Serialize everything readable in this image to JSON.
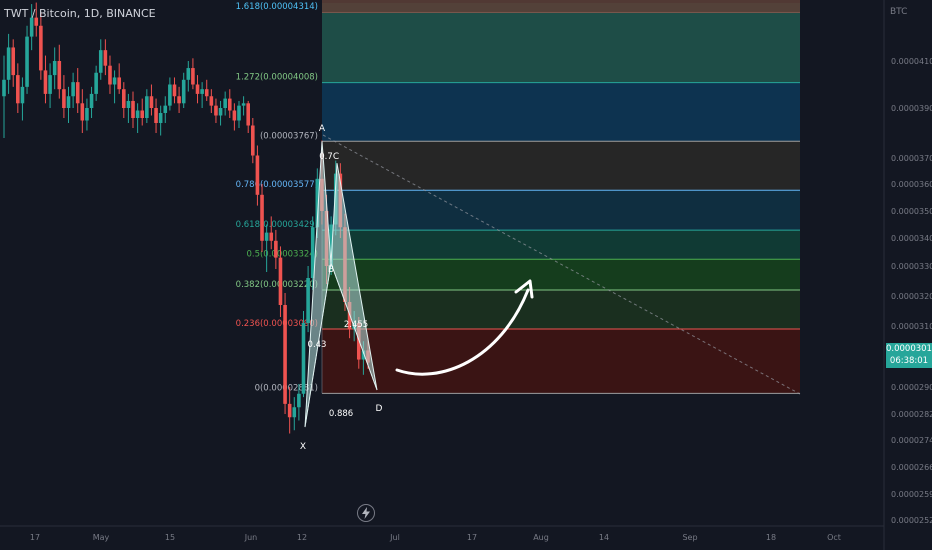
{
  "header": {
    "symbol_text": "TWT / Bitcoin, 1D, BINANCE",
    "axis_unit": "BTC"
  },
  "current_price": {
    "value": "0.00003017",
    "countdown": "06:38:01",
    "color": "#26a69a"
  },
  "toolbar": {
    "replay_icon": "lightning-bolt-icon"
  },
  "chart_data": {
    "type": "candlestick",
    "ylim": [
      2.48e-05,
      4.35e-05
    ],
    "y_ticks": [
      "0.00004100",
      "0.00003900",
      "0.00003700",
      "0.00003600",
      "0.00003500",
      "0.00003400",
      "0.00003300",
      "0.00003200",
      "0.00003100",
      "0.00002900",
      "0.00002820",
      "0.00002740",
      "0.00002660",
      "0.00002590",
      "0.00002520"
    ],
    "x_ticks": [
      "17",
      "May",
      "15",
      "Jun",
      "12",
      "Jul",
      "17",
      "Aug",
      "14",
      "Sep",
      "18",
      "Oct"
    ],
    "fib_levels": [
      {
        "ratio": "1.618",
        "value": "0.00004314",
        "label": "1.618(0.00004314)",
        "color": "#5d4037",
        "text_color": "#4fc3f7"
      },
      {
        "ratio": "1.272",
        "value": "0.00004008",
        "label": "1.272(0.00004008)",
        "color": "#26a69a",
        "text_color": "#81c784"
      },
      {
        "ratio": "1",
        "value": "0.00003767",
        "label": "(0.00003767)",
        "color": "#9e9e9e",
        "text_color": "#b2b5be"
      },
      {
        "ratio": "0.786",
        "value": "0.00003577",
        "label": "0.786(0.00003577)",
        "color": "#64b5f6",
        "text_color": "#64b5f6"
      },
      {
        "ratio": "0.618",
        "value": "0.00003429",
        "label": "0.618(0.00003429)",
        "color": "#26a69a",
        "text_color": "#26a69a"
      },
      {
        "ratio": "0.5",
        "value": "0.00003324",
        "label": "0.5(0.00003324)",
        "color": "#4caf50",
        "text_color": "#4caf50"
      },
      {
        "ratio": "0.382",
        "value": "0.00003220",
        "label": "0.382(0.00003220)",
        "color": "#81c784",
        "text_color": "#81c784"
      },
      {
        "ratio": "0.236",
        "value": "0.00003090",
        "label": "0.236(0.00003090)",
        "color": "#ef5350",
        "text_color": "#ef5350"
      },
      {
        "ratio": "0",
        "value": "0.00002881",
        "label": "0(0.00002881)",
        "color": "#9e9e9e",
        "text_color": "#b2b5be"
      }
    ],
    "fib_bands": [
      {
        "from": "1.618",
        "to": "1.272",
        "color": "#1e4d47"
      },
      {
        "from": "1.272",
        "to": "1",
        "color": "#0d3350"
      },
      {
        "from": "1",
        "to": "0.786",
        "color": "#262626"
      },
      {
        "from": "0.786",
        "to": "0.618",
        "color": "#0f2e40"
      },
      {
        "from": "0.618",
        "to": "0.5",
        "color": "#103a34"
      },
      {
        "from": "0.5",
        "to": "0.382",
        "color": "#153d1d"
      },
      {
        "from": "0.382",
        "to": "0.236",
        "color": "#1a2f1f"
      },
      {
        "from": "0.236",
        "to": "0",
        "color": "#3a1414"
      }
    ],
    "pattern_points": [
      {
        "label": "X",
        "price": 2.78e-05
      },
      {
        "label": "A",
        "price": 3.767e-05
      },
      {
        "label": "B",
        "price": 3.31e-05
      },
      {
        "label": "C",
        "price": 3.68e-05
      },
      {
        "label": "D",
        "price": 2.87e-05
      }
    ],
    "pattern_ratios": [
      "0.7",
      "0.43",
      "2.455",
      "0.886"
    ],
    "candles": [
      [
        3.95e-05,
        4.12e-05,
        3.78e-05,
        4.02e-05
      ],
      [
        4.02e-05,
        4.2e-05,
        3.96e-05,
        4.15e-05
      ],
      [
        4.15e-05,
        4.18e-05,
        3.99e-05,
        4.04e-05
      ],
      [
        4.04e-05,
        4.09e-05,
        3.88e-05,
        3.92e-05
      ],
      [
        3.92e-05,
        4.03e-05,
        3.85e-05,
        3.99e-05
      ],
      [
        3.99e-05,
        4.23e-05,
        3.96e-05,
        4.19e-05
      ],
      [
        4.19e-05,
        4.31e-05,
        4.14e-05,
        4.26e-05
      ],
      [
        4.26e-05,
        4.33e-05,
        4.19e-05,
        4.23e-05
      ],
      [
        4.23e-05,
        4.28e-05,
        4.02e-05,
        4.06e-05
      ],
      [
        4.06e-05,
        4.12e-05,
        3.92e-05,
        3.96e-05
      ],
      [
        3.96e-05,
        4.09e-05,
        3.9e-05,
        4.04e-05
      ],
      [
        4.04e-05,
        4.15e-05,
        3.98e-05,
        4.1e-05
      ],
      [
        4.1e-05,
        4.16e-05,
        3.94e-05,
        3.98e-05
      ],
      [
        3.98e-05,
        4.04e-05,
        3.86e-05,
        3.9e-05
      ],
      [
        3.9e-05,
        3.99e-05,
        3.84e-05,
        3.95e-05
      ],
      [
        3.95e-05,
        4.05e-05,
        3.9e-05,
        4.01e-05
      ],
      [
        4.01e-05,
        4.07e-05,
        3.88e-05,
        3.92e-05
      ],
      [
        3.92e-05,
        3.98e-05,
        3.8e-05,
        3.85e-05
      ],
      [
        3.85e-05,
        3.94e-05,
        3.81e-05,
        3.9e-05
      ],
      [
        3.9e-05,
        3.99e-05,
        3.86e-05,
        3.96e-05
      ],
      [
        3.96e-05,
        4.08e-05,
        3.93e-05,
        4.05e-05
      ],
      [
        4.05e-05,
        4.18e-05,
        4.02e-05,
        4.14e-05
      ],
      [
        4.14e-05,
        4.18e-05,
        4.04e-05,
        4.08e-05
      ],
      [
        4.08e-05,
        4.12e-05,
        3.96e-05,
        4e-05
      ],
      [
        4e-05,
        4.06e-05,
        3.92e-05,
        4.03e-05
      ],
      [
        4.03e-05,
        4.09e-05,
        3.96e-05,
        3.98e-05
      ],
      [
        3.98e-05,
        4.01e-05,
        3.86e-05,
        3.9e-05
      ],
      [
        3.9e-05,
        3.96e-05,
        3.84e-05,
        3.93e-05
      ],
      [
        3.93e-05,
        3.97e-05,
        3.82e-05,
        3.86e-05
      ],
      [
        3.86e-05,
        3.92e-05,
        3.8e-05,
        3.89e-05
      ],
      [
        3.89e-05,
        3.94e-05,
        3.83e-05,
        3.86e-05
      ],
      [
        3.86e-05,
        3.98e-05,
        3.84e-05,
        3.95e-05
      ],
      [
        3.95e-05,
        4e-05,
        3.87e-05,
        3.9e-05
      ],
      [
        3.9e-05,
        3.94e-05,
        3.8e-05,
        3.84e-05
      ],
      [
        3.84e-05,
        3.91e-05,
        3.79e-05,
        3.88e-05
      ],
      [
        3.88e-05,
        3.95e-05,
        3.84e-05,
        3.91e-05
      ],
      [
        3.91e-05,
        4.03e-05,
        3.89e-05,
        4e-05
      ],
      [
        4e-05,
        4.03e-05,
        3.92e-05,
        3.95e-05
      ],
      [
        3.95e-05,
        3.99e-05,
        3.88e-05,
        3.92e-05
      ],
      [
        3.92e-05,
        4.05e-05,
        3.9e-05,
        4.02e-05
      ],
      [
        4.02e-05,
        4.1e-05,
        3.97e-05,
        4.07e-05
      ],
      [
        4.07e-05,
        4.11e-05,
        3.98e-05,
        4e-05
      ],
      [
        4e-05,
        4.04e-05,
        3.92e-05,
        3.96e-05
      ],
      [
        3.96e-05,
        4.01e-05,
        3.9e-05,
        3.98e-05
      ],
      [
        3.98e-05,
        4.02e-05,
        3.93e-05,
        3.95e-05
      ],
      [
        3.95e-05,
        3.98e-05,
        3.88e-05,
        3.91e-05
      ],
      [
        3.91e-05,
        3.94e-05,
        3.84e-05,
        3.87e-05
      ],
      [
        3.87e-05,
        3.93e-05,
        3.83e-05,
        3.9e-05
      ],
      [
        3.9e-05,
        3.97e-05,
        3.87e-05,
        3.94e-05
      ],
      [
        3.94e-05,
        3.98e-05,
        3.86e-05,
        3.89e-05
      ],
      [
        3.89e-05,
        3.92e-05,
        3.81e-05,
        3.85e-05
      ],
      [
        3.85e-05,
        3.93e-05,
        3.82e-05,
        3.91e-05
      ],
      [
        3.91e-05,
        3.95e-05,
        3.87e-05,
        3.92e-05
      ],
      [
        3.92e-05,
        3.93e-05,
        3.8e-05,
        3.83e-05
      ],
      [
        3.83e-05,
        3.86e-05,
        3.68e-05,
        3.71e-05
      ],
      [
        3.71e-05,
        3.75e-05,
        3.52e-05,
        3.56e-05
      ],
      [
        3.56e-05,
        3.6e-05,
        3.35e-05,
        3.39e-05
      ],
      [
        3.39e-05,
        3.45e-05,
        3.28e-05,
        3.42e-05
      ],
      [
        3.42e-05,
        3.48e-05,
        3.36e-05,
        3.39e-05
      ],
      [
        3.39e-05,
        3.43e-05,
        3.29e-05,
        3.33e-05
      ],
      [
        3.33e-05,
        3.37e-05,
        3.13e-05,
        3.17e-05
      ],
      [
        3.17e-05,
        3.21e-05,
        2.82e-05,
        2.85e-05
      ],
      [
        2.85e-05,
        2.9e-05,
        2.76e-05,
        2.81e-05
      ],
      [
        2.81e-05,
        2.87e-05,
        2.77e-05,
        2.84e-05
      ],
      [
        2.84e-05,
        2.91e-05,
        2.8e-05,
        2.88e-05
      ],
      [
        2.88e-05,
        3.15e-05,
        2.87e-05,
        3.11e-05
      ],
      [
        3.11e-05,
        3.3e-05,
        3.08e-05,
        3.26e-05
      ],
      [
        3.26e-05,
        3.48e-05,
        3.22e-05,
        3.44e-05
      ],
      [
        3.44e-05,
        3.66e-05,
        3.4e-05,
        3.62e-05
      ],
      [
        3.62e-05,
        3.77e-05,
        3.45e-05,
        3.5e-05
      ],
      [
        3.5e-05,
        3.56e-05,
        3.24e-05,
        3.3e-05
      ],
      [
        3.3e-05,
        3.48e-05,
        3.27e-05,
        3.45e-05
      ],
      [
        3.45e-05,
        3.69e-05,
        3.41e-05,
        3.64e-05
      ],
      [
        3.64e-05,
        3.68e-05,
        3.4e-05,
        3.44e-05
      ],
      [
        3.44e-05,
        3.49e-05,
        3.15e-05,
        3.18e-05
      ],
      [
        3.18e-05,
        3.23e-05,
        3.06e-05,
        3.09e-05
      ],
      [
        3.09e-05,
        3.15e-05,
        3.05e-05,
        3.11e-05
      ],
      [
        3.11e-05,
        3.13e-05,
        2.96e-05,
        2.99e-05
      ],
      [
        2.99e-05,
        3.05e-05,
        2.94e-05,
        3.02e-05
      ],
      [
        3.02e-05,
        3.06e-05,
        2.96e-05,
        2.98e-05
      ]
    ]
  }
}
